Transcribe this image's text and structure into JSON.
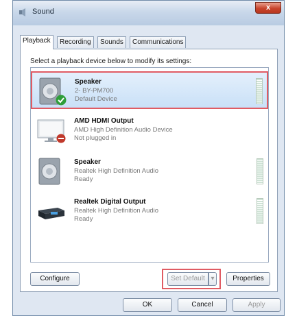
{
  "window": {
    "title": "Sound",
    "close_label": "x"
  },
  "tabs": [
    {
      "label": "Playback"
    },
    {
      "label": "Recording"
    },
    {
      "label": "Sounds"
    },
    {
      "label": "Communications"
    }
  ],
  "panel": {
    "instruction": "Select a playback device below to modify its settings:"
  },
  "devices": [
    {
      "name": "Speaker",
      "desc": "2- BY-PM700",
      "status": "Default Device",
      "icon": "speaker-icon",
      "selected": true
    },
    {
      "name": "AMD HDMI Output",
      "desc": "AMD High Definition Audio Device",
      "status": "Not plugged in",
      "icon": "monitor-icon"
    },
    {
      "name": "Speaker",
      "desc": "Realtek High Definition Audio",
      "status": "Ready",
      "icon": "speaker-icon"
    },
    {
      "name": "Realtek Digital Output",
      "desc": "Realtek High Definition Audio",
      "status": "Ready",
      "icon": "digital-output-icon"
    }
  ],
  "buttons": {
    "configure": "Configure",
    "set_default": "Set Default",
    "properties": "Properties",
    "ok": "OK",
    "cancel": "Cancel",
    "apply": "Apply"
  },
  "colors": {
    "selection": "#c9e0f7",
    "highlight_box": "#e05b63",
    "default_check": "#2e9e3a",
    "unplugged": "#c0392b"
  }
}
